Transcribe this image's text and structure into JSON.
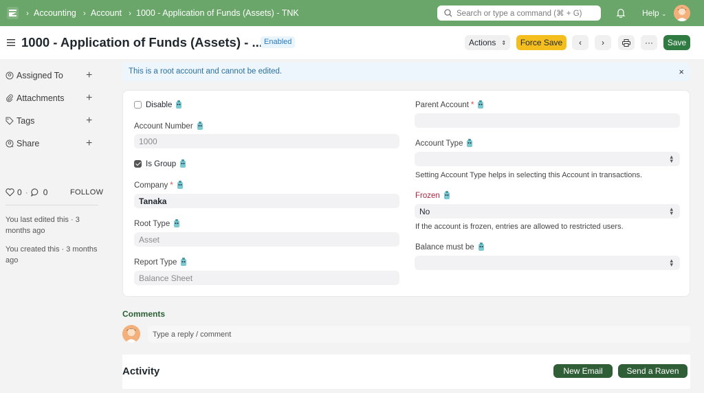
{
  "navbar": {
    "breadcrumbs": [
      "Accounting",
      "Account",
      "1000 - Application of Funds (Assets) - TNK"
    ],
    "search_placeholder": "Search or type a command (⌘ + G)",
    "help_label": "Help"
  },
  "header": {
    "title": "1000 - Application of Funds (Assets) - ...",
    "status": "Enabled",
    "actions_label": "Actions",
    "force_save_label": "Force Save",
    "more_label": "···",
    "save_label": "Save"
  },
  "sidebar": {
    "items": [
      {
        "label": "Assigned To",
        "icon": "assign-icon"
      },
      {
        "label": "Attachments",
        "icon": "paperclip-icon"
      },
      {
        "label": "Tags",
        "icon": "tag-icon"
      },
      {
        "label": "Share",
        "icon": "share-icon"
      }
    ],
    "likes": "0",
    "comments_count": "0",
    "follow_label": "FOLLOW",
    "last_edited": "You last edited this · 3 months ago",
    "created": "You created this · 3 months ago"
  },
  "alert": {
    "text": "This is a root account and cannot be edited.",
    "close": "×"
  },
  "form": {
    "disable_label": "Disable",
    "account_number_label": "Account Number",
    "account_number_value": "1000",
    "is_group_label": "Is Group",
    "company_label": "Company",
    "company_value": "Tanaka",
    "root_type_label": "Root Type",
    "root_type_value": "Asset",
    "report_type_label": "Report Type",
    "report_type_value": "Balance Sheet",
    "parent_account_label": "Parent Account",
    "parent_account_value": "",
    "account_type_label": "Account Type",
    "account_type_value": "",
    "account_type_desc": "Setting Account Type helps in selecting this Account in transactions.",
    "frozen_label": "Frozen",
    "frozen_value": "No",
    "frozen_desc": "If the account is frozen, entries are allowed to restricted users.",
    "balance_label": "Balance must be",
    "balance_value": "",
    "required_mark": "*"
  },
  "comments": {
    "title": "Comments",
    "placeholder": "Type a reply / comment"
  },
  "activity": {
    "title": "Activity",
    "new_email_label": "New Email",
    "send_raven_label": "Send a Raven"
  },
  "colors": {
    "navbar": "#6aa66a",
    "primary": "#2f7b41",
    "force_save": "#f5be1f",
    "alert_bg": "#edf6fd"
  }
}
